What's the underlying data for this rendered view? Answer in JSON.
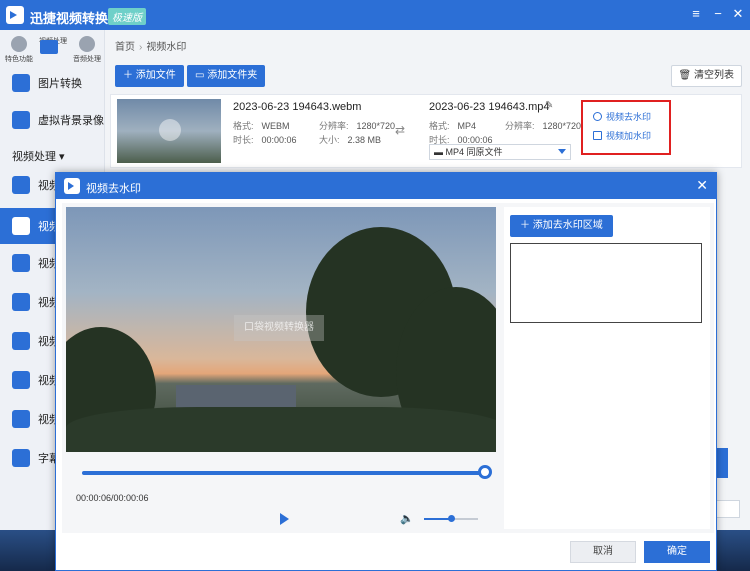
{
  "app": {
    "title": "迅捷视频转换器",
    "badge": "极速版",
    "accent": "#2c6fd6"
  },
  "topnav": [
    {
      "label": "特色功能",
      "icon": "star-icon"
    },
    {
      "label": "视频处理",
      "icon": "video-icon"
    },
    {
      "label": "音频处理",
      "icon": "audio-icon"
    }
  ],
  "sidebar": {
    "items": [
      {
        "label": "图片转换",
        "icon": "image-icon"
      },
      {
        "label": "虚拟背景录像",
        "icon": "camera-icon"
      }
    ],
    "section": "视频处理",
    "sub_items": [
      {
        "label": "视频",
        "icon": "video-icon"
      },
      {
        "label": "视频",
        "icon": "user-video-icon"
      },
      {
        "label": "视频",
        "icon": "film-icon"
      },
      {
        "label": "视频",
        "icon": "film-icon"
      },
      {
        "label": "视频",
        "icon": "gif-icon"
      },
      {
        "label": "视频",
        "icon": "film-icon"
      },
      {
        "label": "视频",
        "icon": "play-circle-icon"
      },
      {
        "label": "字幕",
        "icon": "star-icon"
      }
    ]
  },
  "breadcrumb": {
    "home": "首页",
    "current": "视频水印"
  },
  "toolbar": {
    "add_file": "添加文件",
    "add_folder": "添加文件夹",
    "clear_list": "清空列表"
  },
  "file": {
    "src_name": "2023-06-23 194643.webm",
    "src_format_label": "格式:",
    "src_format": "WEBM",
    "src_res_label": "分辨率:",
    "src_res": "1280*720",
    "src_dur_label": "时长:",
    "src_dur": "00:00:06",
    "src_size_label": "大小:",
    "src_size": "2.38 MB",
    "out_name": "2023-06-23 194643.mp4",
    "out_format_label": "格式:",
    "out_format": "MP4",
    "out_res_label": "分辨率:",
    "out_res": "1280*720",
    "out_dur_label": "时长:",
    "out_dur": "00:00:06",
    "format_select": "MP4   同原文件",
    "action_remove_wm": "视频去水印",
    "action_add_wm": "视频加水印"
  },
  "modal": {
    "title": "视频去水印",
    "watermark_text": "口袋视频转换器",
    "time": "00:00:06/00:00:06",
    "progress": 1.0,
    "volume": 0.5,
    "add_area": "添加去水印区域",
    "cancel": "取消",
    "ok": "确定"
  }
}
